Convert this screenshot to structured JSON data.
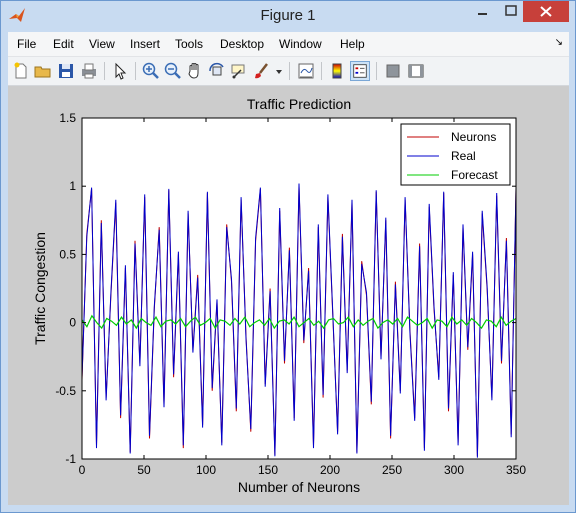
{
  "window": {
    "title": "Figure 1"
  },
  "menu": [
    "File",
    "Edit",
    "View",
    "Insert",
    "Tools",
    "Desktop",
    "Window",
    "Help"
  ],
  "dock_arrow": "↘",
  "toolbar_icons": [
    "new-figure-icon",
    "open-file-icon",
    "save-icon",
    "print-icon",
    "edit-plot-arrow-icon",
    "zoom-in-icon",
    "zoom-out-icon",
    "pan-hand-icon",
    "rotate-3d-icon",
    "data-cursor-icon",
    "brush-icon",
    "brush-dropdown-icon",
    "link-plot-icon",
    "insert-colorbar-icon",
    "insert-legend-icon",
    "hide-plot-tools-icon",
    "show-plot-tools-icon"
  ],
  "colors": {
    "neurons": "#c00000",
    "real": "#0000cc",
    "forecast": "#00cc00",
    "figure_bg": "#cccccc",
    "close": "#c7403a"
  },
  "chart_data": {
    "type": "line",
    "title": "Traffic Prediction",
    "xlabel": "Number of Neurons",
    "ylabel": "Traffic Congestion",
    "xlim": [
      0,
      350
    ],
    "ylim": [
      -1,
      1.5
    ],
    "xticks": [
      0,
      50,
      100,
      150,
      200,
      250,
      300,
      350
    ],
    "yticks": [
      -1,
      -0.5,
      0,
      0.5,
      1,
      1.5
    ],
    "xtick_labels": [
      "0",
      "50",
      "100",
      "150",
      "200",
      "250",
      "300",
      "350"
    ],
    "ytick_labels": [
      "-1",
      "-0.5",
      "0",
      "0.5",
      "1",
      "1.5"
    ],
    "legend_position": "top-right",
    "series": [
      {
        "name": "Neurons",
        "values": [
          -0.42,
          0.65,
          0.98,
          -0.9,
          0.75,
          -0.55,
          0.2,
          0.88,
          -0.7,
          0.4,
          -0.95,
          0.6,
          -0.3,
          0.92,
          -0.85,
          0.1,
          0.7,
          -0.6,
          0.97,
          -0.4,
          0.5,
          -0.92,
          0.8,
          -0.2,
          0.35,
          -0.75,
          0.95,
          -0.5,
          0.15,
          -0.88,
          0.72,
          0.3,
          -0.65,
          0.9,
          -0.1,
          -0.8,
          0.6,
          0.98,
          -0.45,
          0.25,
          -0.97,
          0.82,
          -0.3,
          0.55,
          -0.7,
          1.0,
          -0.15,
          0.4,
          -0.9,
          0.7,
          -0.55,
          0.92,
          0.05,
          -0.8,
          0.65,
          -0.35,
          0.88,
          -0.95,
          0.45,
          0.2,
          -0.6,
          0.96,
          -0.25,
          0.75,
          -0.85,
          0.3,
          -0.5,
          0.9,
          -0.05,
          -0.7,
          0.58,
          -0.92,
          0.85,
          0.1,
          -0.4,
          0.95,
          -0.65,
          0.35,
          -0.88,
          0.7,
          -0.2,
          0.5,
          -0.98,
          0.8,
          0.25,
          -0.55,
          0.93,
          -0.3,
          0.62,
          -0.82,
          0.98
        ]
      },
      {
        "name": "Real",
        "values": [
          -0.4,
          0.63,
          0.99,
          -0.92,
          0.73,
          -0.57,
          0.22,
          0.9,
          -0.68,
          0.42,
          -0.96,
          0.58,
          -0.32,
          0.94,
          -0.83,
          0.12,
          0.68,
          -0.62,
          0.98,
          -0.38,
          0.52,
          -0.9,
          0.82,
          -0.22,
          0.33,
          -0.77,
          0.96,
          -0.48,
          0.17,
          -0.9,
          0.7,
          0.32,
          -0.63,
          0.92,
          -0.12,
          -0.78,
          0.62,
          0.99,
          -0.47,
          0.23,
          -0.98,
          0.84,
          -0.28,
          0.53,
          -0.72,
          1.02,
          -0.13,
          0.38,
          -0.92,
          0.72,
          -0.53,
          0.94,
          0.07,
          -0.82,
          0.63,
          -0.37,
          0.9,
          -0.96,
          0.43,
          0.22,
          -0.58,
          0.97,
          -0.27,
          0.77,
          -0.83,
          0.28,
          -0.52,
          0.92,
          -0.07,
          -0.72,
          0.56,
          -0.94,
          0.87,
          0.12,
          -0.42,
          0.96,
          -0.63,
          0.37,
          -0.9,
          0.72,
          -0.18,
          0.52,
          -0.99,
          0.82,
          0.27,
          -0.57,
          0.95,
          -0.28,
          0.6,
          -0.84,
          0.99
        ]
      },
      {
        "name": "Forecast",
        "values": [
          0.02,
          -0.03,
          0.05,
          0.0,
          -0.04,
          0.03,
          0.01,
          -0.02,
          0.04,
          -0.01,
          0.02,
          -0.04,
          0.03,
          0.0,
          -0.02,
          0.04,
          -0.03,
          0.01,
          0.02,
          -0.01,
          0.03,
          -0.03,
          0.01,
          0.04,
          -0.02,
          0.0,
          0.03,
          -0.04,
          0.02,
          0.01,
          -0.02,
          0.03,
          -0.01,
          0.04,
          -0.03,
          0.0,
          0.02,
          -0.02,
          0.03,
          -0.04,
          0.01,
          0.02,
          -0.01,
          0.04,
          -0.03,
          0.0,
          0.03,
          -0.02,
          0.01,
          -0.04,
          0.02,
          0.03,
          -0.01,
          0.0,
          0.04,
          -0.03,
          0.02,
          -0.02,
          0.01,
          0.03,
          -0.04,
          0.0,
          0.02,
          -0.01,
          0.03,
          -0.03,
          0.04,
          0.01,
          -0.02,
          0.0,
          0.03,
          -0.04,
          0.02,
          0.01,
          -0.03,
          0.04,
          -0.01,
          0.02,
          -0.02,
          0.03,
          0.0,
          -0.04,
          0.02,
          0.01,
          -0.03,
          0.04,
          -0.02,
          0.01,
          0.03
        ]
      }
    ]
  }
}
